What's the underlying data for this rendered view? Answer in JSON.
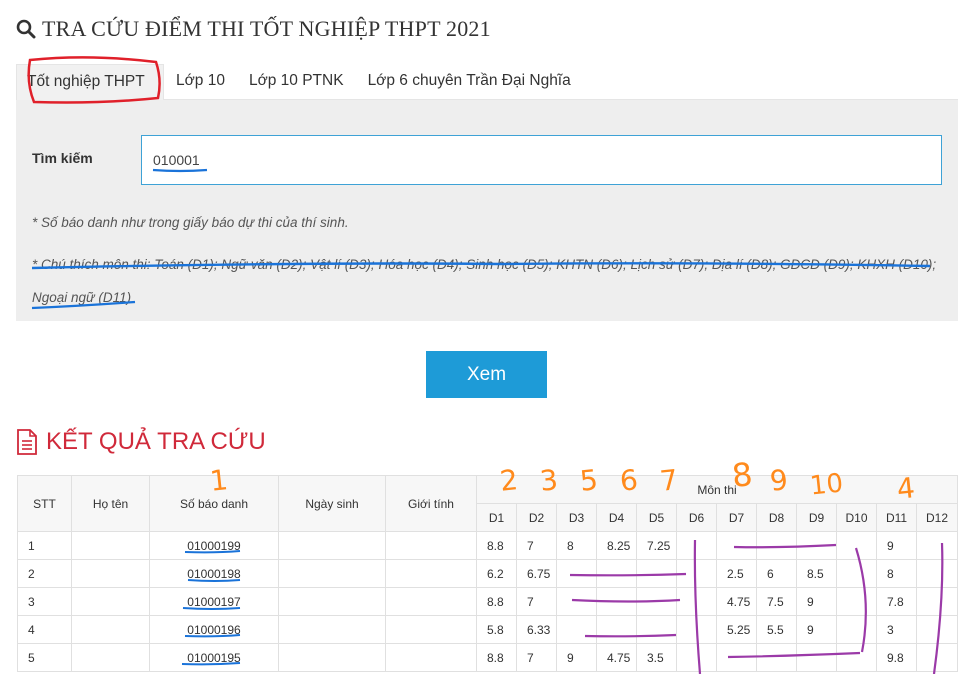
{
  "header": {
    "title": "TRA CỨU ĐIỂM THI TỐT NGHIỆP THPT 2021"
  },
  "tabs": [
    {
      "label": "Tốt nghiệp THPT"
    },
    {
      "label": "Lớp 10"
    },
    {
      "label": "Lớp 10 PTNK"
    },
    {
      "label": "Lớp 6 chuyên Trần Đại Nghĩa"
    }
  ],
  "search": {
    "label": "Tìm kiếm",
    "value": "010001",
    "note1": "* Số báo danh như trong giấy báo dự thi của thí sinh.",
    "note2": "* Chú thích môn thi: Toán (D1); Ngữ văn (D2); Vật lí (D3); Hóa học (D4); Sinh học (D5); KHTN (D6); Lịch sử (D7); Địa lí (D8); GDCD (D9); KHXH (D10); Ngoại ngữ (D11)",
    "submit_label": "Xem"
  },
  "results": {
    "title": "KẾT QUẢ TRA CỨU",
    "columns": {
      "stt": "STT",
      "name": "Họ tên",
      "sbd": "Số báo danh",
      "dob": "Ngày sinh",
      "gender": "Giới tính",
      "subjects": "Môn thi",
      "subject_codes": [
        "D1",
        "D2",
        "D3",
        "D4",
        "D5",
        "D6",
        "D7",
        "D8",
        "D9",
        "D10",
        "D11",
        "D12"
      ]
    },
    "rows": [
      {
        "stt": "1",
        "name": "",
        "sbd": "01000199",
        "dob": "",
        "gender": "",
        "scores": [
          "8.8",
          "7",
          "8",
          "8.25",
          "7.25",
          "",
          "",
          "",
          "",
          "",
          "9",
          ""
        ]
      },
      {
        "stt": "2",
        "name": "",
        "sbd": "01000198",
        "dob": "",
        "gender": "",
        "scores": [
          "6.2",
          "6.75",
          "",
          "",
          "",
          "",
          "2.5",
          "6",
          "8.5",
          "",
          "8",
          ""
        ]
      },
      {
        "stt": "3",
        "name": "",
        "sbd": "01000197",
        "dob": "",
        "gender": "",
        "scores": [
          "8.8",
          "7",
          "",
          "",
          "",
          "",
          "4.75",
          "7.5",
          "9",
          "",
          "7.8",
          ""
        ]
      },
      {
        "stt": "4",
        "name": "",
        "sbd": "01000196",
        "dob": "",
        "gender": "",
        "scores": [
          "5.8",
          "6.33",
          "",
          "",
          "",
          "",
          "5.25",
          "5.5",
          "9",
          "",
          "3",
          ""
        ]
      },
      {
        "stt": "5",
        "name": "",
        "sbd": "01000195",
        "dob": "",
        "gender": "",
        "scores": [
          "8.8",
          "7",
          "9",
          "4.75",
          "3.5",
          "",
          "",
          "",
          "",
          "",
          "9.8",
          ""
        ]
      }
    ]
  },
  "annotations": {
    "numbers": [
      "1",
      "2",
      "3",
      "5",
      "6",
      "7",
      "8",
      "9",
      "10",
      "4"
    ],
    "colors": {
      "red": "#e0202a",
      "blue": "#1a73d9",
      "orange": "#ff8a1c",
      "purple": "#9b3aa8"
    }
  }
}
